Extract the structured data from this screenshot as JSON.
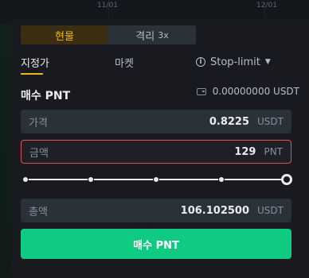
{
  "chart": {
    "dates": [
      "11/01",
      "12/01"
    ]
  },
  "segment": {
    "spot": "현물",
    "margin": "격리",
    "margin_leverage": "3x"
  },
  "tabs": {
    "limit": "지정가",
    "market": "마켓",
    "stop_limit": "Stop-limit",
    "info_icon_glyph": "i"
  },
  "order": {
    "title": "매수 PNT",
    "available": "0.00000000 USDT"
  },
  "fields": {
    "price": {
      "label": "가격",
      "value": "0.8225",
      "unit": "USDT"
    },
    "amount": {
      "label": "금액",
      "value": "129",
      "unit": "PNT"
    },
    "total": {
      "label": "총액",
      "value": "106.102500",
      "unit": "USDT"
    }
  },
  "slider": {
    "percent": 100,
    "marks": [
      0,
      25,
      50,
      75,
      100
    ]
  },
  "buy_button": {
    "label": "매수 PNT"
  },
  "colors": {
    "accent": "#f0b90b",
    "buy": "#0ecb81",
    "error_border": "#e0515a",
    "background": "#181a20",
    "field_bg": "#2b3139"
  }
}
